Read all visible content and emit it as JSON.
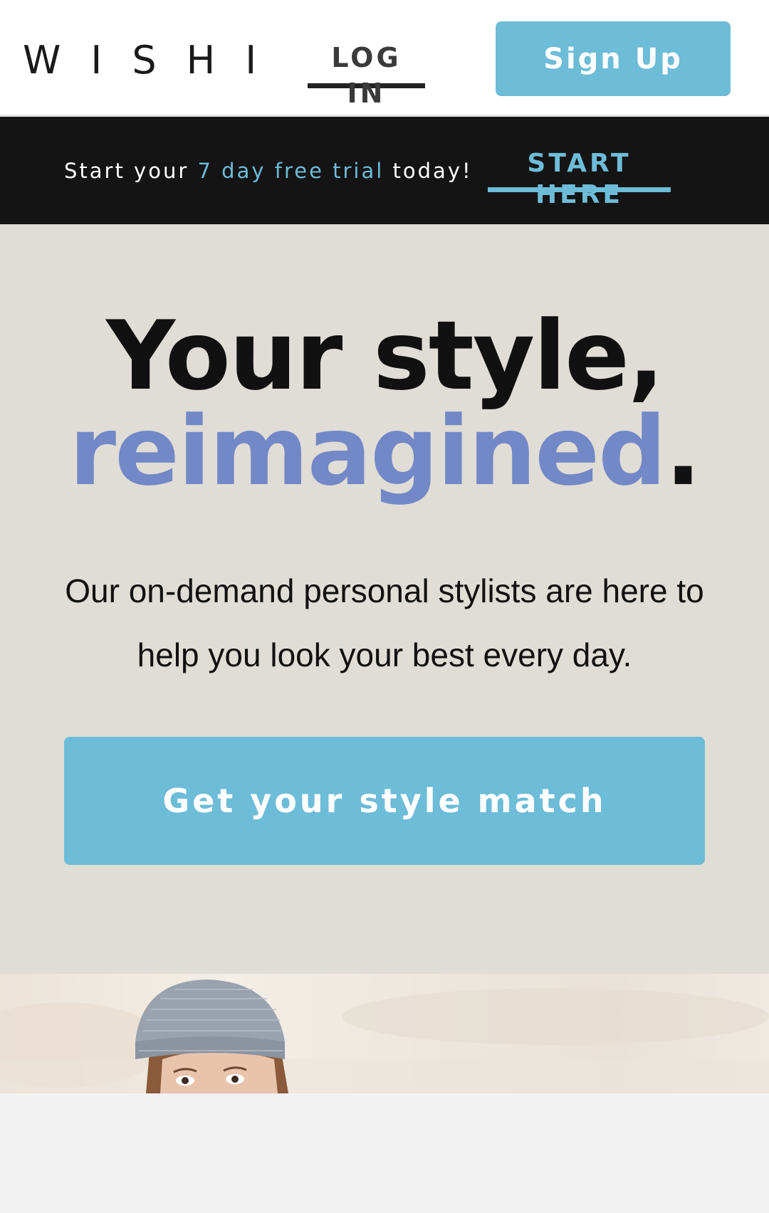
{
  "header": {
    "logo": "WISHI",
    "login_label": "LOG IN",
    "signup_label": "Sign Up"
  },
  "promo": {
    "text_before": "Start your ",
    "text_accent": "7 day free trial",
    "text_after": " today!",
    "cta_label": "START HERE"
  },
  "hero": {
    "headline_line1": "Your style,",
    "headline_highlight": "reimagined",
    "headline_period": ".",
    "subtitle": "Our on-demand personal stylists are here to help you look your best every day.",
    "cta_label": "Get your style match"
  },
  "colors": {
    "accent_blue": "#6dbcd8",
    "highlight_purple": "#7388c6",
    "hero_bg": "#e0ddd6",
    "banner_bg": "#141414"
  },
  "icons": {
    "hero_image": "woman-in-beanie-photo"
  }
}
